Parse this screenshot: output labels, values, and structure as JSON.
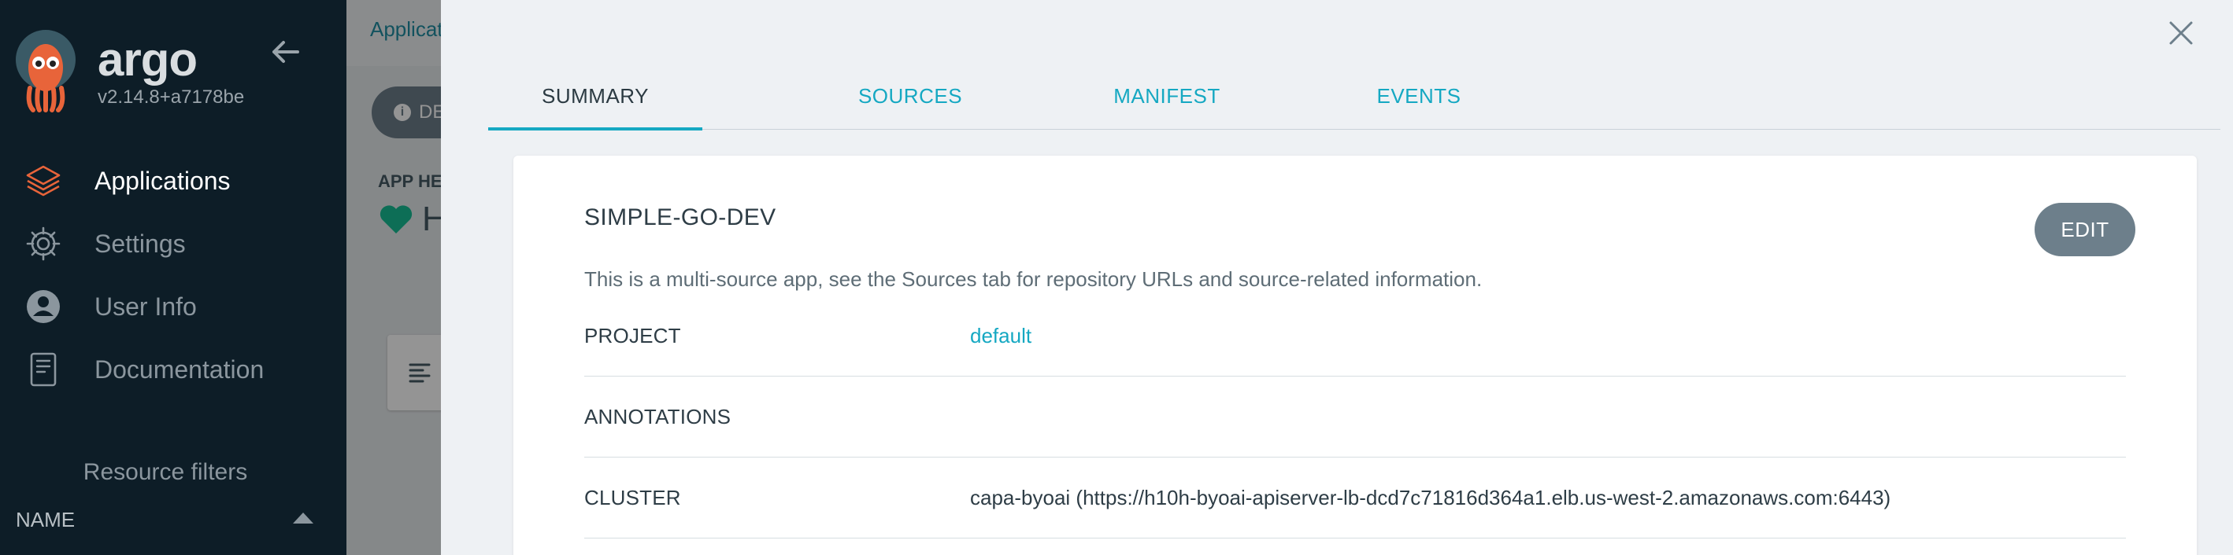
{
  "sidebar": {
    "brand_name": "argo",
    "version": "v2.14.8+a7178be",
    "nav": [
      {
        "label": "Applications",
        "icon": "layers-icon",
        "active": true
      },
      {
        "label": "Settings",
        "icon": "gear-icon",
        "active": false
      },
      {
        "label": "User Info",
        "icon": "user-circle-icon",
        "active": false
      },
      {
        "label": "Documentation",
        "icon": "book-icon",
        "active": false
      }
    ],
    "filters_title": "Resource filters",
    "filters_name_label": "NAME"
  },
  "app": {
    "breadcrumb": "Applicat",
    "details_button": "DE",
    "health_label": "APP HE",
    "health_value": "H"
  },
  "panel": {
    "tabs": [
      {
        "label": "SUMMARY",
        "active": true
      },
      {
        "label": "SOURCES",
        "active": false
      },
      {
        "label": "MANIFEST",
        "active": false
      },
      {
        "label": "EVENTS",
        "active": false
      }
    ],
    "card": {
      "title": "SIMPLE-GO-DEV",
      "edit_label": "EDIT",
      "description": "This is a multi-source app, see the Sources tab for repository URLs and source-related information.",
      "rows": [
        {
          "label": "PROJECT",
          "value": "default",
          "link": true
        },
        {
          "label": "ANNOTATIONS",
          "value": "",
          "link": false
        },
        {
          "label": "CLUSTER",
          "value": "capa-byoai (https://h10h-byoai-apiserver-lb-dcd7c71816d364a1.elb.us-west-2.amazonaws.com:6443)",
          "link": false
        }
      ]
    }
  },
  "colors": {
    "sidebar_bg": "#0d1d27",
    "accent": "#15a8c2",
    "healthy": "#18be94",
    "button_gray": "#6d7f8b"
  }
}
